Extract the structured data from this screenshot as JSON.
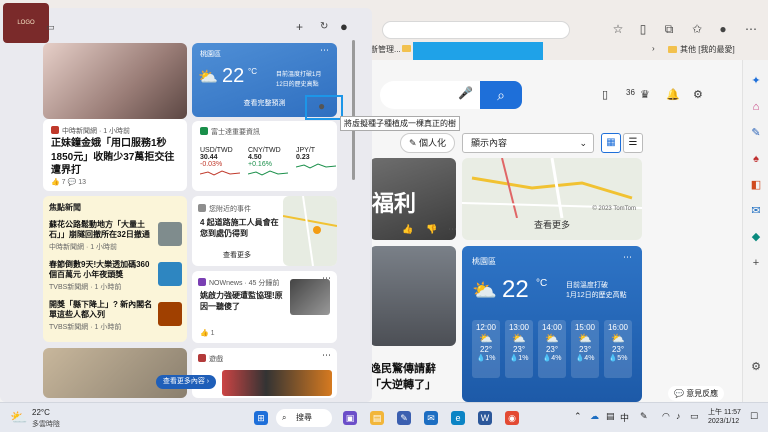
{
  "browser": {
    "bookmarks": {
      "item1": "斷管理...",
      "item2": "其他 [我的最愛]"
    }
  },
  "msn": {
    "zoom_badge": "36",
    "personalize_label": "個人化",
    "display_select": "顯示內容",
    "dark_card_big_text": "福利",
    "map_see_more": "查看更多",
    "copyright": "© 2023 TomTom",
    "news_caption_line1": "逸民驚傳請辭",
    "news_caption_line2": "「大逆轉了」",
    "weather": {
      "location": "桃園區",
      "temp": "22",
      "unit": "°C",
      "note_line1": "目前溫度打破",
      "note_line2": "1月12日的歷史高點",
      "hours": [
        {
          "time": "12:00",
          "temp": "22°",
          "pct": "1%"
        },
        {
          "time": "13:00",
          "temp": "23°",
          "pct": "1%"
        },
        {
          "time": "14:00",
          "temp": "23°",
          "pct": "4%"
        },
        {
          "time": "15:00",
          "temp": "23°",
          "pct": "4%"
        },
        {
          "time": "16:00",
          "temp": "23°",
          "pct": "5%"
        }
      ]
    },
    "feedback_label": "意見反應",
    "tooltip": "將虛擬種子種植成一棵真正的樹"
  },
  "widgets": {
    "news1": {
      "source": "中時新聞網 · 1 小時前",
      "headline": "正妹鐘金娥「用口服務1秒1850元」收賄少37萬拒交往遭界打",
      "likes": "7",
      "comments": "13"
    },
    "weather": {
      "location": "桃園區",
      "temp": "22",
      "unit": "°C",
      "note_line1": "目前溫度打破1月",
      "note_line2": "12日的歷史高點",
      "link": "查看完整預測"
    },
    "stocks": {
      "source": "富士達重要資訊",
      "tickers": [
        {
          "name": "USD/TWD",
          "value": "30.44",
          "change": "-0.03%"
        },
        {
          "name": "CNY/TWD",
          "value": "4.50",
          "change": "+0.16%"
        },
        {
          "name": "JPY/T",
          "value": "0.23",
          "change": ""
        }
      ]
    },
    "focus": {
      "title": "焦點新聞",
      "items": [
        {
          "text": "蘇花公路鬆動地方「大量土石」」崩隧回撤所在32日撤通",
          "meta": "中時新聞網 · 1 小時前"
        },
        {
          "text": "春節倒數9天!大樂透加碼360個百萬元 小年夜頭獎",
          "meta": "TVBS新聞網 · 1 小時前"
        },
        {
          "text": "開獎「縣下降上」? 新內閣名單這些人都入列",
          "meta": "TVBS新聞網 · 1 小時前"
        }
      ]
    },
    "traffic": {
      "source": "您附近的事件",
      "headline": "4 起道路施工人員會在您到處仍得到",
      "link": "查看更多"
    },
    "sports": {
      "source": "NOWnews · 45 分鐘前",
      "headline": "姚啟力強硬遭監協理!原因一聽傻了",
      "likes": "1"
    },
    "games_label": "遊戲",
    "see_more_feed": "查看更多內容"
  },
  "taskbar": {
    "weather_temp": "22°C",
    "weather_desc": "多雲時陰",
    "search_label": "搜尋",
    "ime": "中",
    "time": "上午 11:57",
    "date": "2023/1/12"
  }
}
